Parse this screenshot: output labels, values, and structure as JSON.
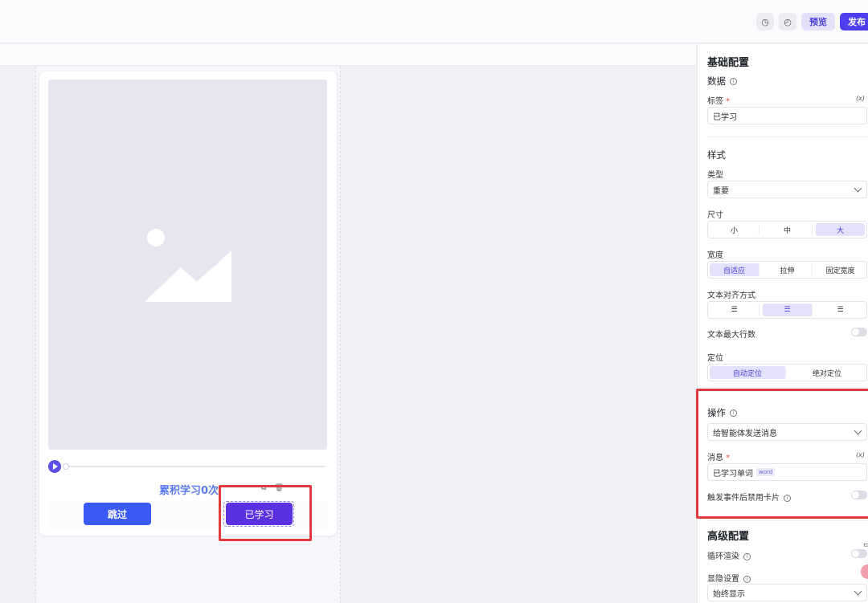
{
  "topbar": {
    "icon1": "clock-icon",
    "icon2": "history-icon",
    "preview_label": "预览",
    "publish_label": "发布"
  },
  "card": {
    "image_icon": "image-placeholder-icon",
    "study_count": "累积学习0次",
    "skip_label": "跳过",
    "learned_label": "已学习",
    "tool_copy": "⧉",
    "tool_delete": "🗑"
  },
  "panel": {
    "basic_title": "基础配置",
    "data_title": "数据",
    "label_title": "标签",
    "required_mark": "*",
    "var_icon": "(x)",
    "label_value": "已学习",
    "style_title": "样式",
    "type_title": "类型",
    "type_value": "重要",
    "size_title": "尺寸",
    "size_options": [
      "小",
      "中",
      "大"
    ],
    "size_selected": "大",
    "width_title": "宽度",
    "width_options": [
      "自适应",
      "拉伸",
      "固定宽度"
    ],
    "width_selected": "自适应",
    "align_title": "文本对齐方式",
    "align_options": [
      "☰",
      "☰",
      "☰"
    ],
    "max_lines_title": "文本最大行数",
    "position_title": "定位",
    "position_options": [
      "自动定位",
      "绝对定位"
    ],
    "position_selected": "自动定位",
    "action_title": "操作",
    "action_value": "给智能体发送消息",
    "message_title": "消息",
    "message_value": "已学习单词",
    "message_tag": "word",
    "disable_after_title": "触发事件后禁用卡片",
    "advanced_title": "高级配置",
    "loop_title": "循环渲染",
    "visibility_title": "显隐设置",
    "visibility_value": "始终显示"
  },
  "colors": {
    "accent": "#4d3ff0",
    "learned_btn": "#5b30e0",
    "skip_btn": "#3a5af5",
    "highlight": "#e23a3a"
  }
}
